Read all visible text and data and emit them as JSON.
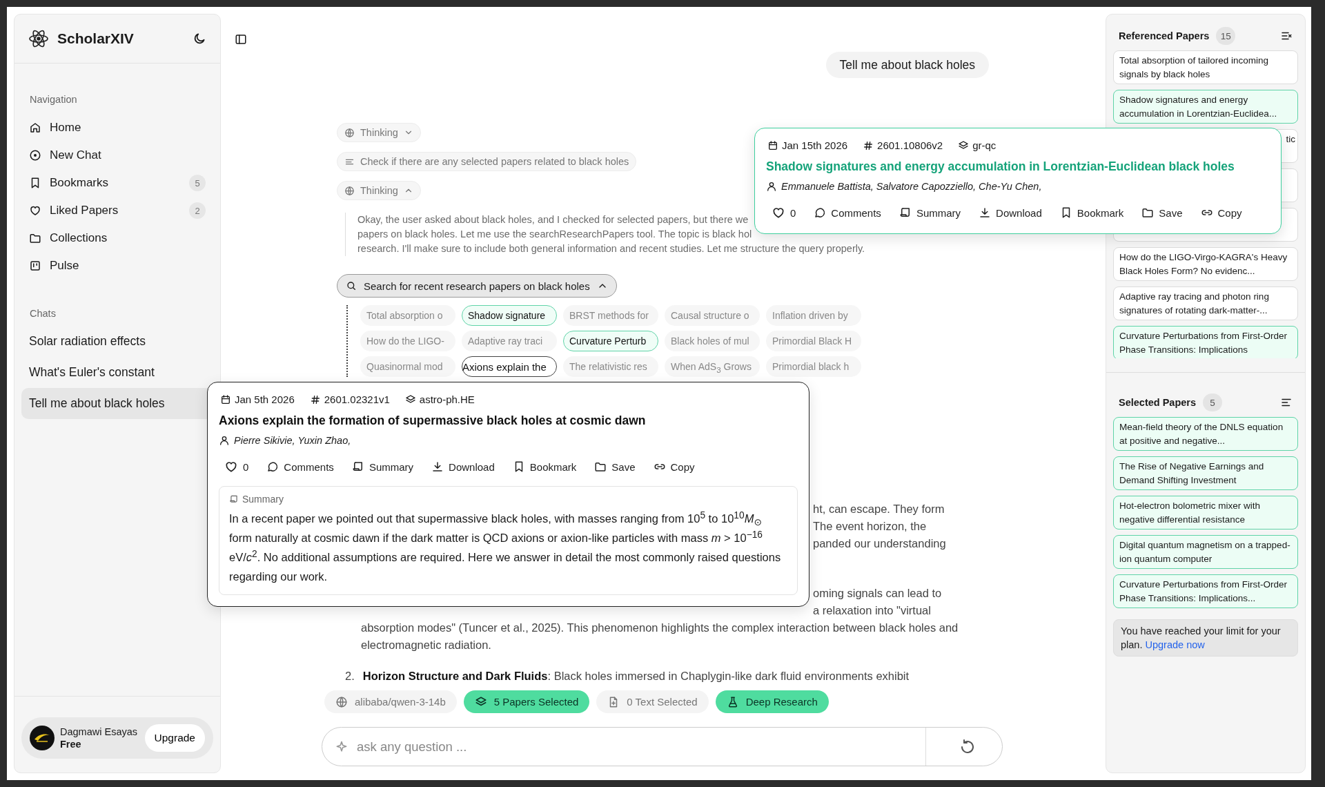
{
  "app": {
    "name": "ScholarXIV"
  },
  "sidebar": {
    "nav_label": "Navigation",
    "items": [
      {
        "kind": "home",
        "label": "Home"
      },
      {
        "kind": "new_chat",
        "label": "New Chat"
      },
      {
        "kind": "bookmarks",
        "label": "Bookmarks",
        "badge": "5"
      },
      {
        "kind": "liked",
        "label": "Liked Papers",
        "badge": "2"
      },
      {
        "kind": "collections",
        "label": "Collections"
      },
      {
        "kind": "pulse",
        "label": "Pulse"
      }
    ],
    "chats_label": "Chats",
    "chats": [
      {
        "label": "Solar radiation effects",
        "selected": false
      },
      {
        "label": "What's Euler's constant",
        "selected": false
      },
      {
        "label": "Tell me about black holes",
        "selected": true
      }
    ],
    "user": {
      "name": "Dagmawi Esayas",
      "plan": "Free",
      "upgrade": "Upgrade"
    }
  },
  "chat": {
    "user_message": "Tell me about black holes",
    "steps": [
      {
        "kind": "thinking",
        "label": "Thinking",
        "expanded": false
      },
      {
        "kind": "task",
        "label": "Check if there are any selected papers related to black holes"
      },
      {
        "kind": "thinking",
        "label": "Thinking",
        "expanded": true,
        "lines": [
          "Okay, the user asked about black holes, and I checked for selected papers, but there we",
          "papers on black holes. Let me use the searchResearchPapers tool. The topic is black hol",
          "research. I'll make sure to include both general information and recent studies. Let me structure the query properly."
        ]
      }
    ],
    "search": {
      "label": "Search for recent research papers on black holes",
      "expanded": true,
      "results": [
        {
          "title": "Total absorption o",
          "selected": false,
          "active": false
        },
        {
          "title": "Shadow signature",
          "selected": true,
          "active": false
        },
        {
          "title": "BRST methods for",
          "selected": false,
          "active": false
        },
        {
          "title": "Causal structure o",
          "selected": false,
          "active": false
        },
        {
          "title": "Inflation driven by",
          "selected": false,
          "active": false
        },
        {
          "title": "How do the LIGO-",
          "selected": false,
          "active": false
        },
        {
          "title": "Adaptive ray traci",
          "selected": false,
          "active": false
        },
        {
          "title": "Curvature Perturb",
          "selected": true,
          "active": false
        },
        {
          "title": "Black holes of mul",
          "selected": false,
          "active": false
        },
        {
          "title": "Primordial Black H",
          "selected": false,
          "active": false
        },
        {
          "title": "Quasinormal mod",
          "selected": false,
          "active": false
        },
        {
          "title": "Axions explain the",
          "selected": false,
          "active": true
        },
        {
          "title": "The relativistic res",
          "selected": false,
          "active": false
        },
        {
          "title": "When AdS$_{3}$ Grows",
          "selected": false,
          "active": false
        },
        {
          "title": "Primordial black h",
          "selected": false,
          "active": false
        }
      ]
    },
    "answer": {
      "covered_lines_a": [
        "ht, can escape. They form",
        "The event horizon, the",
        "panded our understanding"
      ],
      "covered_lines_b": [
        "oming signals can lead to",
        "a relaxation into \"virtual"
      ],
      "paragraph": "absorption modes\" (Tuncer et al., 2025). This phenomenon highlights the complex interaction between black holes and electromagnetic radiation.",
      "list": [
        {
          "number": "2.",
          "text": "**Horizon Structure and Dark Fluids**: Black holes immersed in Chaplygin-like dark fluid environments exhibit"
        }
      ]
    }
  },
  "composer": {
    "chips": [
      {
        "kind": "model",
        "label": "alibaba/qwen-3-14b",
        "on": false
      },
      {
        "kind": "papers",
        "label": "5 Papers Selected",
        "on": true
      },
      {
        "kind": "text",
        "label": "0 Text Selected",
        "on": false
      },
      {
        "kind": "research",
        "label": "Deep Research",
        "on": true
      }
    ],
    "placeholder": "ask any question ..."
  },
  "referenced": {
    "title": "Referenced Papers",
    "count": "15",
    "papers": [
      {
        "kind": "paper",
        "text": "Total absorption of tailored incoming signals by black holes",
        "selected": false
      },
      {
        "kind": "paper",
        "text": "Shadow signatures and energy accumulation in Lorentzian-Euclidea...",
        "selected": true
      },
      {
        "kind": "covered",
        "text": "tic",
        "selected": false
      },
      {
        "kind": "covered",
        "selected": false
      },
      {
        "kind": "covered",
        "selected": false
      },
      {
        "kind": "paper",
        "text": "How do the LIGO-Virgo-KAGRA's Heavy Black Holes Form? No evidenc...",
        "selected": false
      },
      {
        "kind": "paper",
        "text": "Adaptive ray tracing and photon ring signatures of rotating dark-matter-...",
        "selected": false
      },
      {
        "kind": "paper",
        "text": "Curvature Perturbations from First-Order Phase Transitions: Implications",
        "selected": true
      }
    ]
  },
  "selected_papers": {
    "title": "Selected Papers",
    "count": "5",
    "papers": [
      {
        "text": "Mean-field theory of the DNLS equation at positive and negative..."
      },
      {
        "text": "The Rise of Negative Earnings and Demand Shifting Investment"
      },
      {
        "text": "Hot-electron bolometric mixer with negative differential resistance"
      },
      {
        "text": "Digital quantum magnetism on a trapped-ion quantum computer"
      },
      {
        "text": "Curvature Perturbations from First-Order Phase Transitions: Implications..."
      }
    ],
    "limit_notice": "You have reached your limit for your plan.",
    "upgrade_link": "Upgrade now"
  },
  "popovers": [
    {
      "selected": true,
      "date": "Jan 15th 2026",
      "id": "2601.10806v2",
      "category": "gr-qc",
      "title": "Shadow signatures and energy accumulation in Lorentzian-Euclidean black holes",
      "authors": "Emmanuele Battista, Salvatore Capozziello, Che-Yu Chen,",
      "likes": "0",
      "actions": [
        {
          "kind": "comments",
          "label": "Comments"
        },
        {
          "kind": "summary",
          "label": "Summary"
        },
        {
          "kind": "download",
          "label": "Download"
        },
        {
          "kind": "bookmark",
          "label": "Bookmark"
        },
        {
          "kind": "save",
          "label": "Save"
        },
        {
          "kind": "copy",
          "label": "Copy"
        }
      ]
    },
    {
      "selected": false,
      "date": "Jan 5th 2026",
      "id": "2601.02321v1",
      "category": "astro-ph.HE",
      "title": "Axions explain the formation of supermassive black holes at cosmic dawn",
      "authors": "Pierre Sikivie, Yuxin Zhao,",
      "likes": "0",
      "actions": [
        {
          "kind": "comments",
          "label": "Comments"
        },
        {
          "kind": "summary",
          "label": "Summary"
        },
        {
          "kind": "download",
          "label": "Download"
        },
        {
          "kind": "bookmark",
          "label": "Bookmark"
        },
        {
          "kind": "save",
          "label": "Save"
        },
        {
          "kind": "copy",
          "label": "Copy"
        }
      ],
      "summary": {
        "label": "Summary",
        "text": "In a recent paper we pointed out that supermassive black holes, with masses ranging from 10$^{5}$ to 10$^{10}$*M*$_{⊙}$ form naturally at cosmic dawn if the dark matter is QCD axions or axion-like particles with mass *m* > 10$^{−16}$ eV/*c*$^{2}$. No additional assumptions are required. Here we answer in detail the most commonly raised questions regarding our work."
      }
    }
  ]
}
